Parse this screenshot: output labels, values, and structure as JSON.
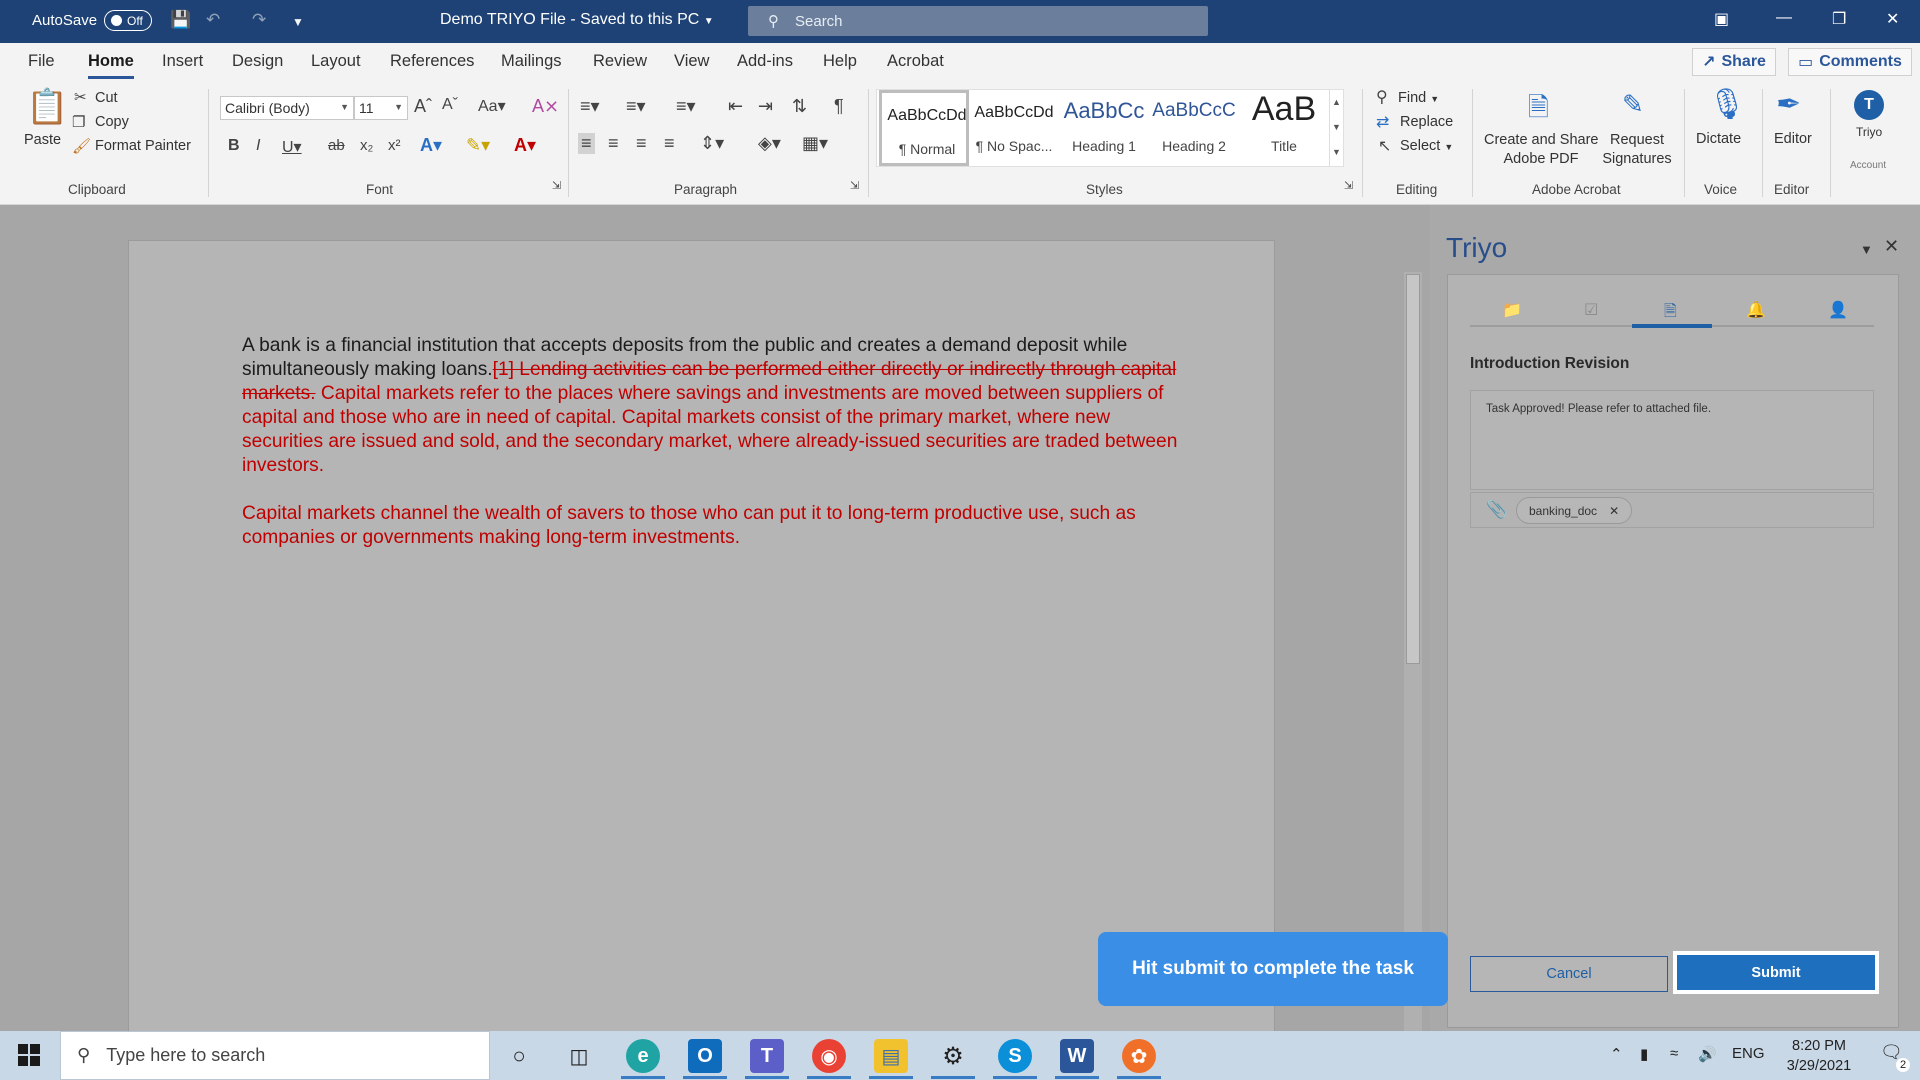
{
  "titlebar": {
    "autosave_label": "AutoSave",
    "autosave_state": "Off",
    "doc_title": "Demo TRIYO File  -  Saved to this PC",
    "search_placeholder": "Search",
    "color": "#1e4275"
  },
  "ribbon_tabs": [
    "File",
    "Home",
    "Insert",
    "Design",
    "Layout",
    "References",
    "Mailings",
    "Review",
    "View",
    "Add-ins",
    "Help",
    "Acrobat"
  ],
  "active_tab": "Home",
  "share_label": "Share",
  "comments_label": "Comments",
  "clipboard": {
    "paste": "Paste",
    "cut": "Cut",
    "copy": "Copy",
    "format_painter": "Format Painter",
    "group": "Clipboard"
  },
  "font": {
    "name": "Calibri (Body)",
    "size": "11",
    "group": "Font"
  },
  "paragraph": {
    "group": "Paragraph"
  },
  "styles": {
    "group": "Styles",
    "items": [
      {
        "preview": "AaBbCcDd",
        "name": "¶ Normal"
      },
      {
        "preview": "AaBbCcDd",
        "name": "¶ No Spac..."
      },
      {
        "preview": "AaBbCc",
        "name": "Heading 1"
      },
      {
        "preview": "AaBbCcC",
        "name": "Heading 2"
      },
      {
        "preview": "AaB",
        "name": "Title"
      }
    ]
  },
  "editing": {
    "find": "Find",
    "replace": "Replace",
    "select": "Select",
    "group": "Editing"
  },
  "acrobat": {
    "create": "Create and Share",
    "create2": "Adobe PDF",
    "request": "Request",
    "request2": "Signatures",
    "group": "Adobe Acrobat"
  },
  "voice": {
    "dictate": "Dictate",
    "group": "Voice"
  },
  "editor": {
    "label": "Editor",
    "group": "Editor"
  },
  "triyo_btn": {
    "letter": "T",
    "label": "Triyo",
    "group": "Account"
  },
  "document": {
    "p1_normal": "A bank is a financial institution that accepts deposits from the public and creates a demand deposit while simultaneously making loans.",
    "p1_deleted": "[1] Lending activities can be performed either directly or indirectly through capital markets.",
    "p1_inserted": " Capital markets refer to the places where savings and investments are moved between suppliers of capital and those who are in need of capital. Capital markets consist of the primary market, where new securities are issued and sold, and the secondary market, where already-issued securities are traded between investors.",
    "p2_inserted": "Capital markets channel the wealth of savers to those who can put it to long-term productive use, such as companies or governments making long-term investments."
  },
  "panel": {
    "title": "Triyo",
    "task_title": "Introduction Revision",
    "message": "Task Approved! Please refer to attached file.",
    "attachment": "banking_doc",
    "cancel": "Cancel",
    "submit": "Submit",
    "tooltip": "Hit submit to complete the task"
  },
  "taskbar": {
    "search_placeholder": "Type here to search",
    "lang": "ENG",
    "time": "8:20 PM",
    "date": "3/29/2021",
    "notifications": "2"
  }
}
